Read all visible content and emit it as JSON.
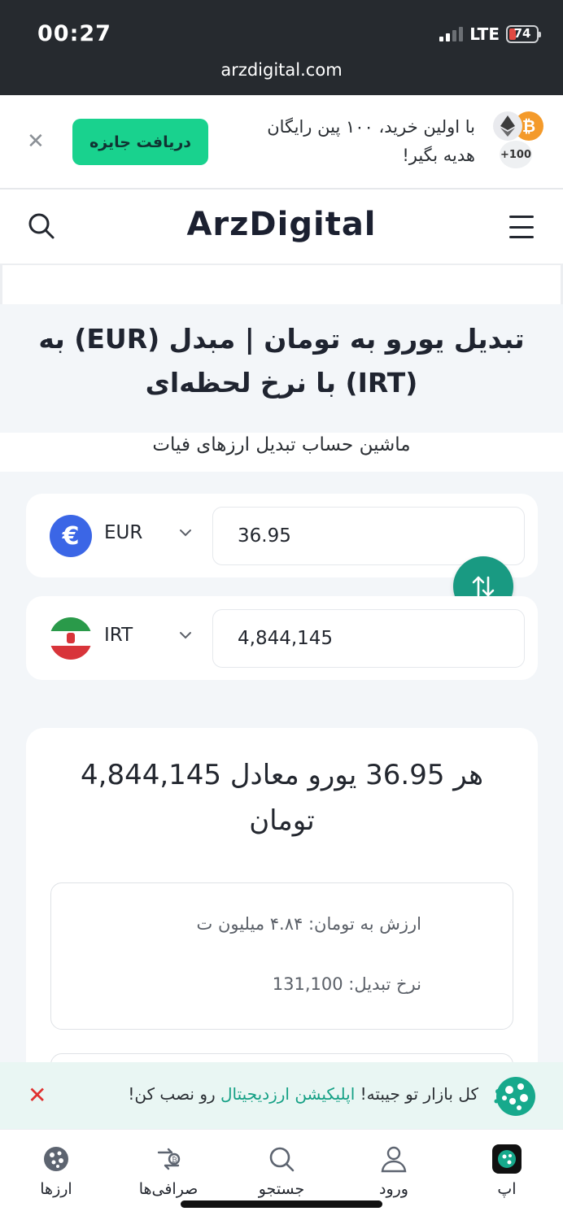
{
  "status_bar": {
    "time": "00:27",
    "network": "LTE",
    "battery": "74",
    "battery_level_percent": 25,
    "url": "arzdigital.com"
  },
  "promo": {
    "message": "با اولین خرید، ۱۰۰ پین رایگان هدیه بگیر!",
    "button_label": "دریافت جایزه",
    "coin_bonus": "+100",
    "close_icon": "close-icon"
  },
  "header": {
    "logo": "ArzDigital",
    "icons": [
      "search-icon",
      "hamburger-menu-icon"
    ]
  },
  "page": {
    "title": "تبدیل یورو به تومان | مبدل (EUR) به (IRT) با نرخ لحظه‌ای",
    "subtitle": "ماشین حساب تبدیل ارزهای فیات"
  },
  "converter": {
    "from": {
      "currency_code": "EUR",
      "amount": "36.95",
      "icon": "euro-icon"
    },
    "to": {
      "currency_code": "IRT",
      "amount": "4,844,145",
      "icon": "iran-flag-icon"
    },
    "swap_icon": "swap-arrows-icon"
  },
  "result": {
    "headline": "هر 36.95 یورو معادل 4,844,145 تومان",
    "value_line": "ارزش به تومان:  ۴.۸۴ میلیون ت",
    "rate_line": "نرخ تبدیل: 131,100"
  },
  "install_banner": {
    "text_before": "کل بازار تو جیبته! ",
    "highlight": "اپلیکیشن ارزدیجیتال",
    "text_after": " رو نصب کن!",
    "accent_color": "#15a085"
  },
  "bottom_nav": {
    "items": [
      {
        "label": "ارزها",
        "icon": "coins-icon"
      },
      {
        "label": "صرافی‌ها",
        "icon": "exchange-icon"
      },
      {
        "label": "جستجو",
        "icon": "search-icon"
      },
      {
        "label": "ورود",
        "icon": "user-icon"
      },
      {
        "label": "اپ",
        "icon": "app-icon"
      }
    ]
  },
  "colors": {
    "status_bar_bg": "#262a2f",
    "primary_green": "#19d28e",
    "swap_teal": "#199a82",
    "content_bg": "#f3f6f9"
  }
}
